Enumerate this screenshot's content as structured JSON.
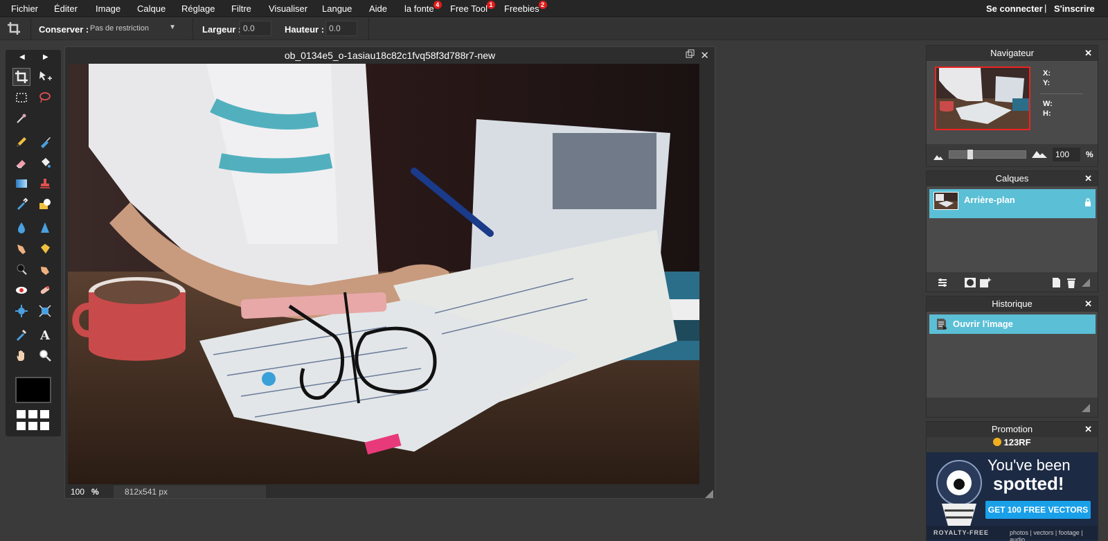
{
  "menu": {
    "items": [
      {
        "label": "Fichier"
      },
      {
        "label": "Éditer"
      },
      {
        "label": "Image"
      },
      {
        "label": "Calque"
      },
      {
        "label": "Réglage"
      },
      {
        "label": "Filtre"
      },
      {
        "label": "Visualiser"
      },
      {
        "label": "Langue"
      },
      {
        "label": "Aide"
      },
      {
        "label": "la fonte",
        "badge": "4"
      },
      {
        "label": "Free Tool",
        "badge": "1"
      },
      {
        "label": "Freebies",
        "badge": "2"
      }
    ],
    "login": "Se connecter",
    "separator": "|",
    "signup": "S'inscrire"
  },
  "options": {
    "conserver_label": "Conserver :",
    "conserver_value": "Pas de restriction",
    "largeur_label": "Largeur :",
    "largeur_value": "0.0",
    "hauteur_label": "Hauteur :",
    "hauteur_value": "0.0"
  },
  "document": {
    "title": "ob_0134e5_o-1asiau18c82c1fvq58f3d788r7-new",
    "zoom": "100",
    "zoom_unit": "%",
    "size": "812x541 px"
  },
  "navigator": {
    "title": "Navigateur",
    "x_label": "X:",
    "y_label": "Y:",
    "w_label": "W:",
    "h_label": "H:",
    "zoom": "100",
    "zoom_unit": "%",
    "zoom_level": 0.25
  },
  "layers": {
    "title": "Calques",
    "items": [
      {
        "name": "Arrière-plan"
      }
    ]
  },
  "history": {
    "title": "Historique",
    "items": [
      {
        "name": "Ouvrir l'image"
      }
    ]
  },
  "promotion": {
    "title": "Promotion",
    "brand": "123RF",
    "line1": "You've been",
    "line2": "spotted!",
    "cta": "GET 100 FREE VECTORS",
    "footer_left": "ROYALTY-FREE",
    "footer_right": "photos | vectors | footage | audio"
  },
  "colors": {
    "accent": "#5bbfd6",
    "badge": "#e01b1b",
    "foreground_color": "#000000"
  }
}
